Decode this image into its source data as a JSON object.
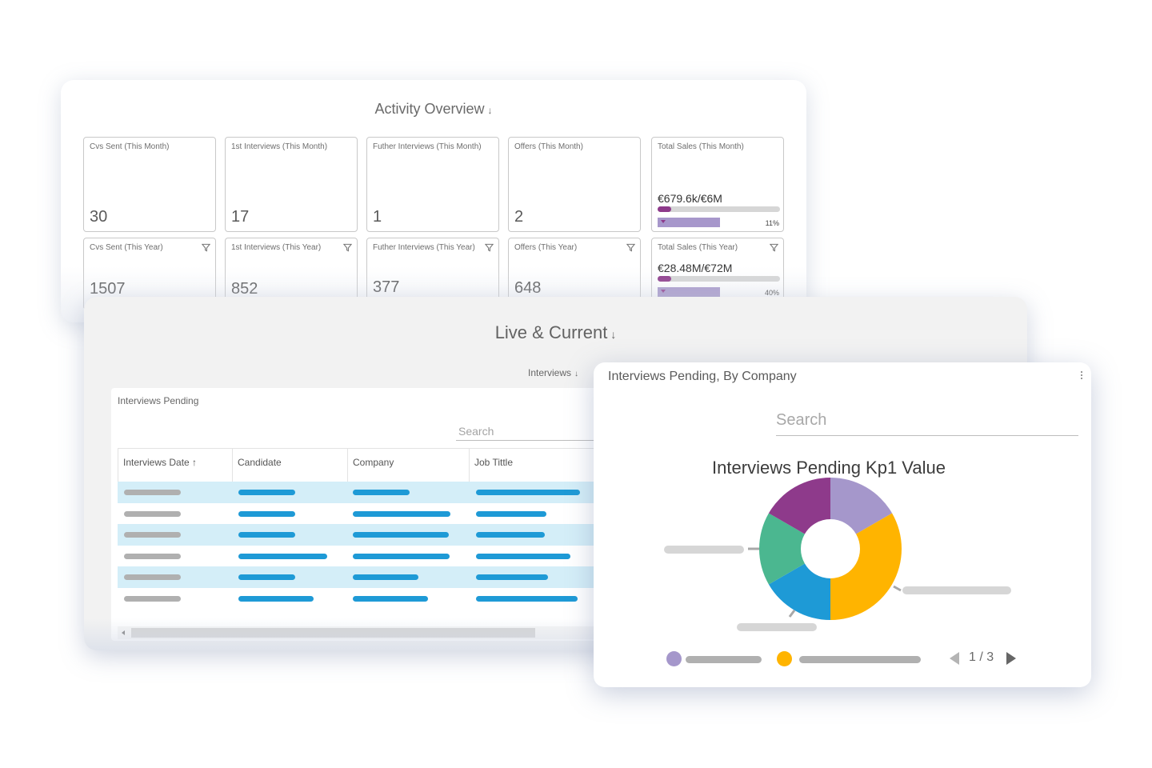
{
  "activity_overview": {
    "title": "Activity Overview",
    "arrow": "↓",
    "kpis_month": [
      {
        "label": "Cvs Sent (This Month)",
        "value": "30"
      },
      {
        "label": "1st Interviews (This Month)",
        "value": "17"
      },
      {
        "label": "Futher Interviews (This Month)",
        "value": "1"
      },
      {
        "label": "Offers (This Month)",
        "value": "2"
      }
    ],
    "sales_month": {
      "label": "Total Sales (This Month)",
      "value": "€679.6k/€6M",
      "progress_percent": 11,
      "percent_label": "11%"
    },
    "kpis_year": [
      {
        "label": "Cvs Sent (This Year)",
        "value": "1507"
      },
      {
        "label": "1st Interviews (This Year)",
        "value": "852"
      },
      {
        "label": "Futher Interviews (This Year)",
        "value": "377"
      },
      {
        "label": "Offers (This Year)",
        "value": "648"
      }
    ],
    "sales_year": {
      "label": "Total Sales (This Year)",
      "value": "€28.48M/€72M",
      "progress_percent": 40,
      "percent_label": "40%"
    },
    "filter_icon": "filter-icon"
  },
  "live_current": {
    "title": "Live & Current",
    "arrow": "↓",
    "sub_tab": {
      "label": "Interviews",
      "arrow": "↓"
    },
    "table_card": {
      "title": "Interviews Pending",
      "search_placeholder": "Search",
      "columns": [
        {
          "label": "Interviews Date ↑",
          "sort": "ascending"
        },
        {
          "label": "Candidate"
        },
        {
          "label": "Company"
        },
        {
          "label": "Job Tittle"
        }
      ],
      "rows_placeholder_count": 6,
      "colors": {
        "row_alt": "#d4eef8",
        "pill_blue": "#1e9ad6",
        "pill_gray": "#b0b0b0"
      }
    }
  },
  "chart_card": {
    "title": "Interviews Pending, By Company",
    "search_placeholder": "Search",
    "menu_icon": "more-vertical-icon",
    "pager": {
      "current": 1,
      "total": 3,
      "label": "1 / 3"
    }
  },
  "chart_data": {
    "type": "pie",
    "variant": "donut",
    "title": "Interviews Pending Kp1 Value",
    "slices": [
      {
        "name": "",
        "value": 1,
        "color": "#a597cb"
      },
      {
        "name": "",
        "value": 2,
        "color": "#ffb400"
      },
      {
        "name": "",
        "value": 1,
        "color": "#1e9ad6"
      },
      {
        "name": "",
        "value": 1,
        "color": "#4bb790"
      },
      {
        "name": "",
        "value": 1,
        "color": "#8e3a8b"
      }
    ],
    "legend": [
      {
        "color": "#a597cb"
      },
      {
        "color": "#ffb400"
      }
    ],
    "legend_placement": "bottom",
    "labels_redacted": true
  }
}
